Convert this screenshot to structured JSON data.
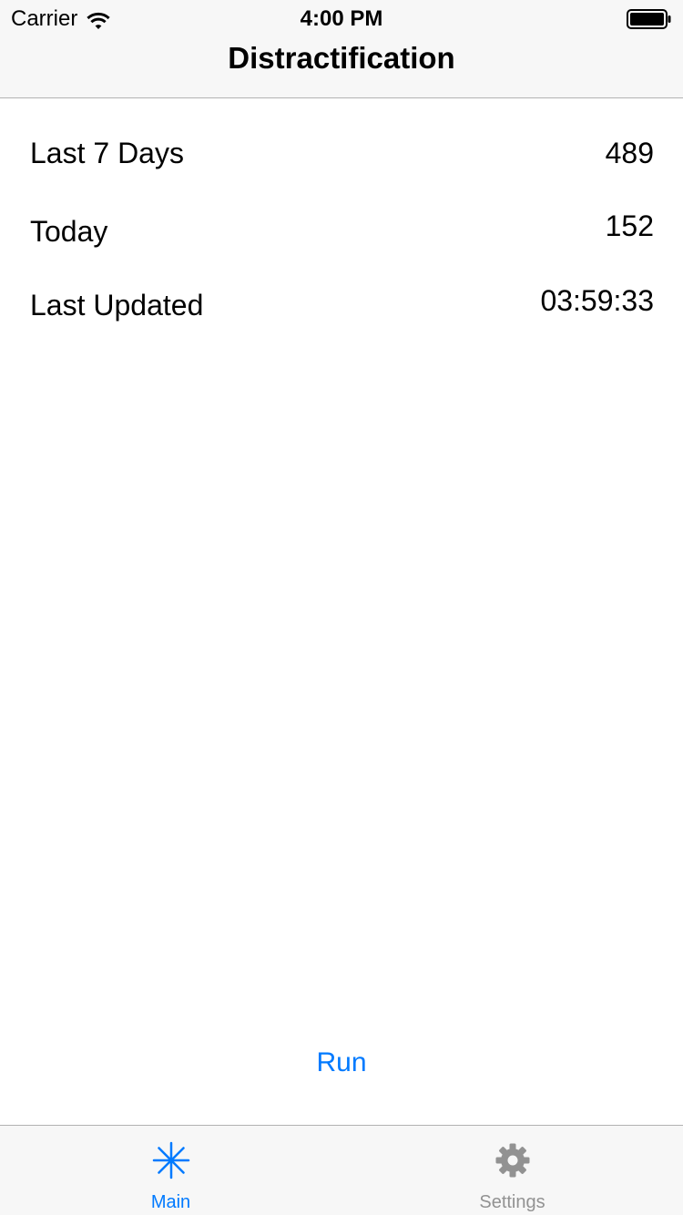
{
  "status_bar": {
    "carrier": "Carrier",
    "time": "4:00 PM",
    "wifi_icon": "wifi-icon",
    "battery_icon": "battery-icon"
  },
  "nav": {
    "title": "Distractification"
  },
  "stats": [
    {
      "label": "Last 7 Days",
      "value": "489"
    },
    {
      "label": "Today",
      "value": "152"
    },
    {
      "label": "Last Updated",
      "value": "03:59:33"
    }
  ],
  "run_button": {
    "label": "Run"
  },
  "tabs": [
    {
      "label": "Main",
      "icon": "asterisk-icon",
      "selected": true
    },
    {
      "label": "Settings",
      "icon": "gear-icon",
      "selected": false
    }
  ],
  "colors": {
    "accent": "#007aff",
    "inactive": "#929292",
    "bar_background": "#f7f7f7"
  }
}
